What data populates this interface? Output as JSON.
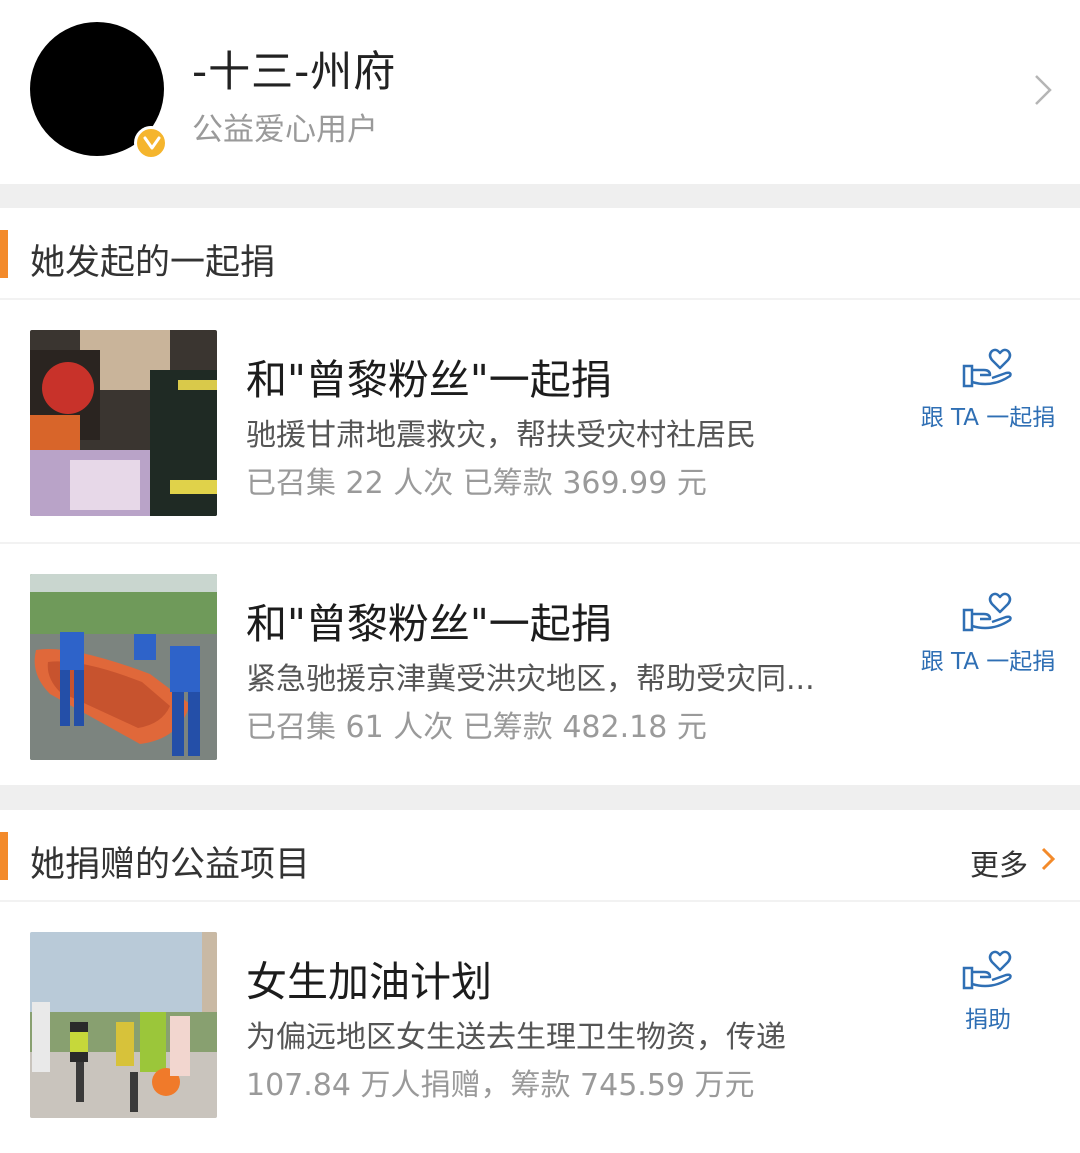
{
  "profile": {
    "name": "-十三-州府",
    "subtitle": "公益爱心用户"
  },
  "initiated": {
    "title": "她发起的一起捐",
    "items": [
      {
        "title": "和\"曾黎粉丝\"一起捐",
        "description": "驰援甘肃地震救灾，帮扶受灾村社居民",
        "stats": "已召集 22 人次 已筹款 369.99 元",
        "action_label": "跟 TA 一起捐"
      },
      {
        "title": "和\"曾黎粉丝\"一起捐",
        "description": "紧急驰援京津冀受洪灾地区，帮助受灾同...",
        "stats": "已召集 61 人次 已筹款 482.18 元",
        "action_label": "跟 TA 一起捐"
      }
    ]
  },
  "donated": {
    "title": "她捐赠的公益项目",
    "more_label": "更多",
    "items": [
      {
        "title": "女生加油计划",
        "description": "为偏远地区女生送去生理卫生物资，传递",
        "stats": "107.84 万人捐赠，筹款 745.59 万元",
        "action_label": "捐助"
      }
    ]
  },
  "colors": {
    "accent": "#f38a2a",
    "link": "#2f6fb4",
    "badge": "#f5b52d"
  },
  "icons": [
    "verified-badge-icon",
    "chevron-right-icon",
    "heart-hand-icon"
  ]
}
